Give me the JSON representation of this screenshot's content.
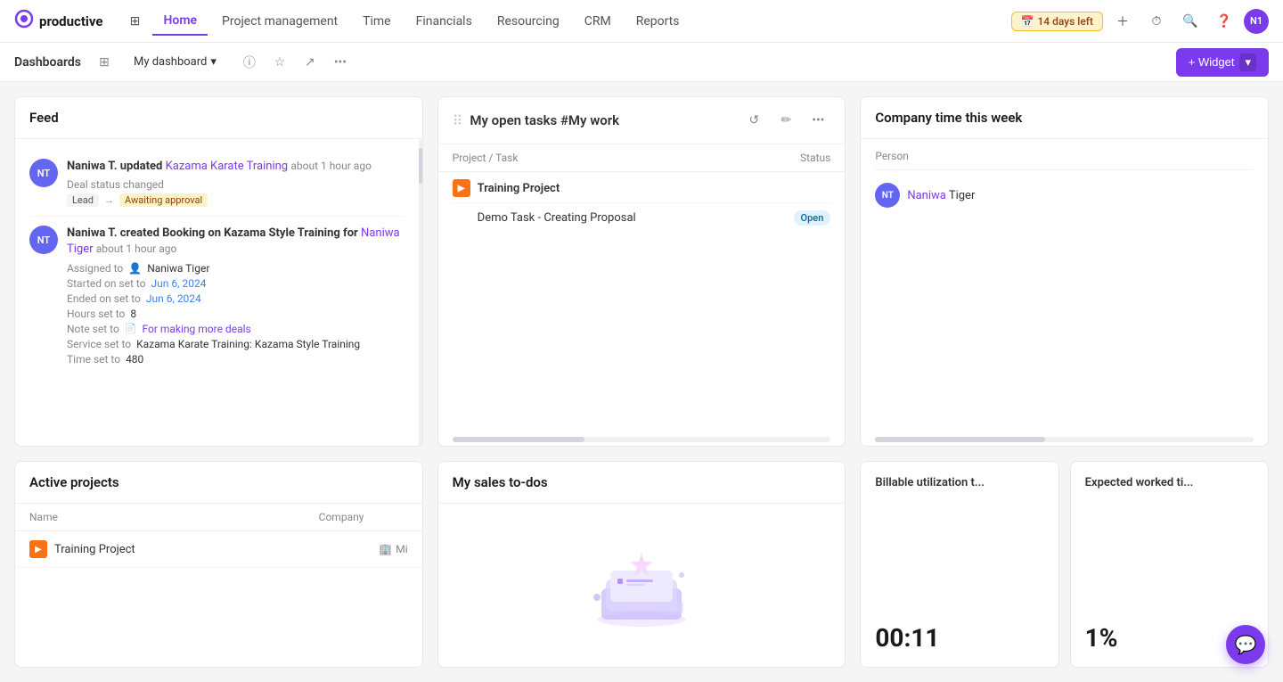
{
  "app": {
    "logo_text": "productive",
    "trial_badge": "14 days left"
  },
  "nav": {
    "items": [
      {
        "label": "Home",
        "active": true
      },
      {
        "label": "Project management",
        "active": false
      },
      {
        "label": "Time",
        "active": false
      },
      {
        "label": "Financials",
        "active": false
      },
      {
        "label": "Resourcing",
        "active": false
      },
      {
        "label": "CRM",
        "active": false
      },
      {
        "label": "Reports",
        "active": false
      }
    ]
  },
  "sub_nav": {
    "title": "Dashboards",
    "dashboard_name": "My dashboard",
    "widget_btn": "+ Widget"
  },
  "feed": {
    "title": "Feed",
    "items": [
      {
        "avatar": "NT",
        "action_text": "Naniwa T. updated",
        "link_text": "Kazama Karate Training",
        "time": "about 1 hour ago",
        "meta": "Deal status changed",
        "from_badge": "Lead",
        "to_badge": "Awaiting approval"
      },
      {
        "avatar": "NT",
        "action_text": "Naniwa T. created Booking on Kazama Style Training for",
        "link_text": "Naniwa Tiger",
        "time": "about 1 hour ago",
        "details": [
          {
            "label": "Assigned to",
            "value": "Naniwa Tiger",
            "type": "normal"
          },
          {
            "label": "Started on set to",
            "value": "Jun 6, 2024",
            "type": "blue"
          },
          {
            "label": "Ended on set to",
            "value": "Jun 6, 2024",
            "type": "blue"
          },
          {
            "label": "Hours set to",
            "value": "8",
            "type": "normal"
          },
          {
            "label": "Note set to",
            "value": "For making more deals",
            "type": "purple"
          },
          {
            "label": "Service set to",
            "value": "Kazama Karate Training: Kazama Style Training",
            "type": "normal"
          },
          {
            "label": "Time set to",
            "value": "480",
            "type": "normal"
          }
        ]
      }
    ]
  },
  "tasks": {
    "title": "My open tasks #My work",
    "col_project": "Project / Task",
    "col_status": "Status",
    "sections": [
      {
        "project": "Training Project",
        "tasks": [
          {
            "name": "Demo Task - Creating Proposal",
            "status": "Open"
          }
        ]
      }
    ]
  },
  "company_time": {
    "title": "Company time this week",
    "col_person": "Person",
    "people": [
      {
        "avatar": "NT",
        "first_name": "Naniwa",
        "last_name": "Tiger"
      }
    ]
  },
  "active_projects": {
    "title": "Active projects",
    "col_name": "Name",
    "col_company": "Company",
    "projects": [
      {
        "name": "Training Project",
        "company": "Mi"
      }
    ]
  },
  "sales_todos": {
    "title": "My sales to-dos"
  },
  "billable": {
    "title": "Billable utilization t...",
    "value": "00:11"
  },
  "expected": {
    "title": "Expected worked ti...",
    "value": "1%"
  }
}
